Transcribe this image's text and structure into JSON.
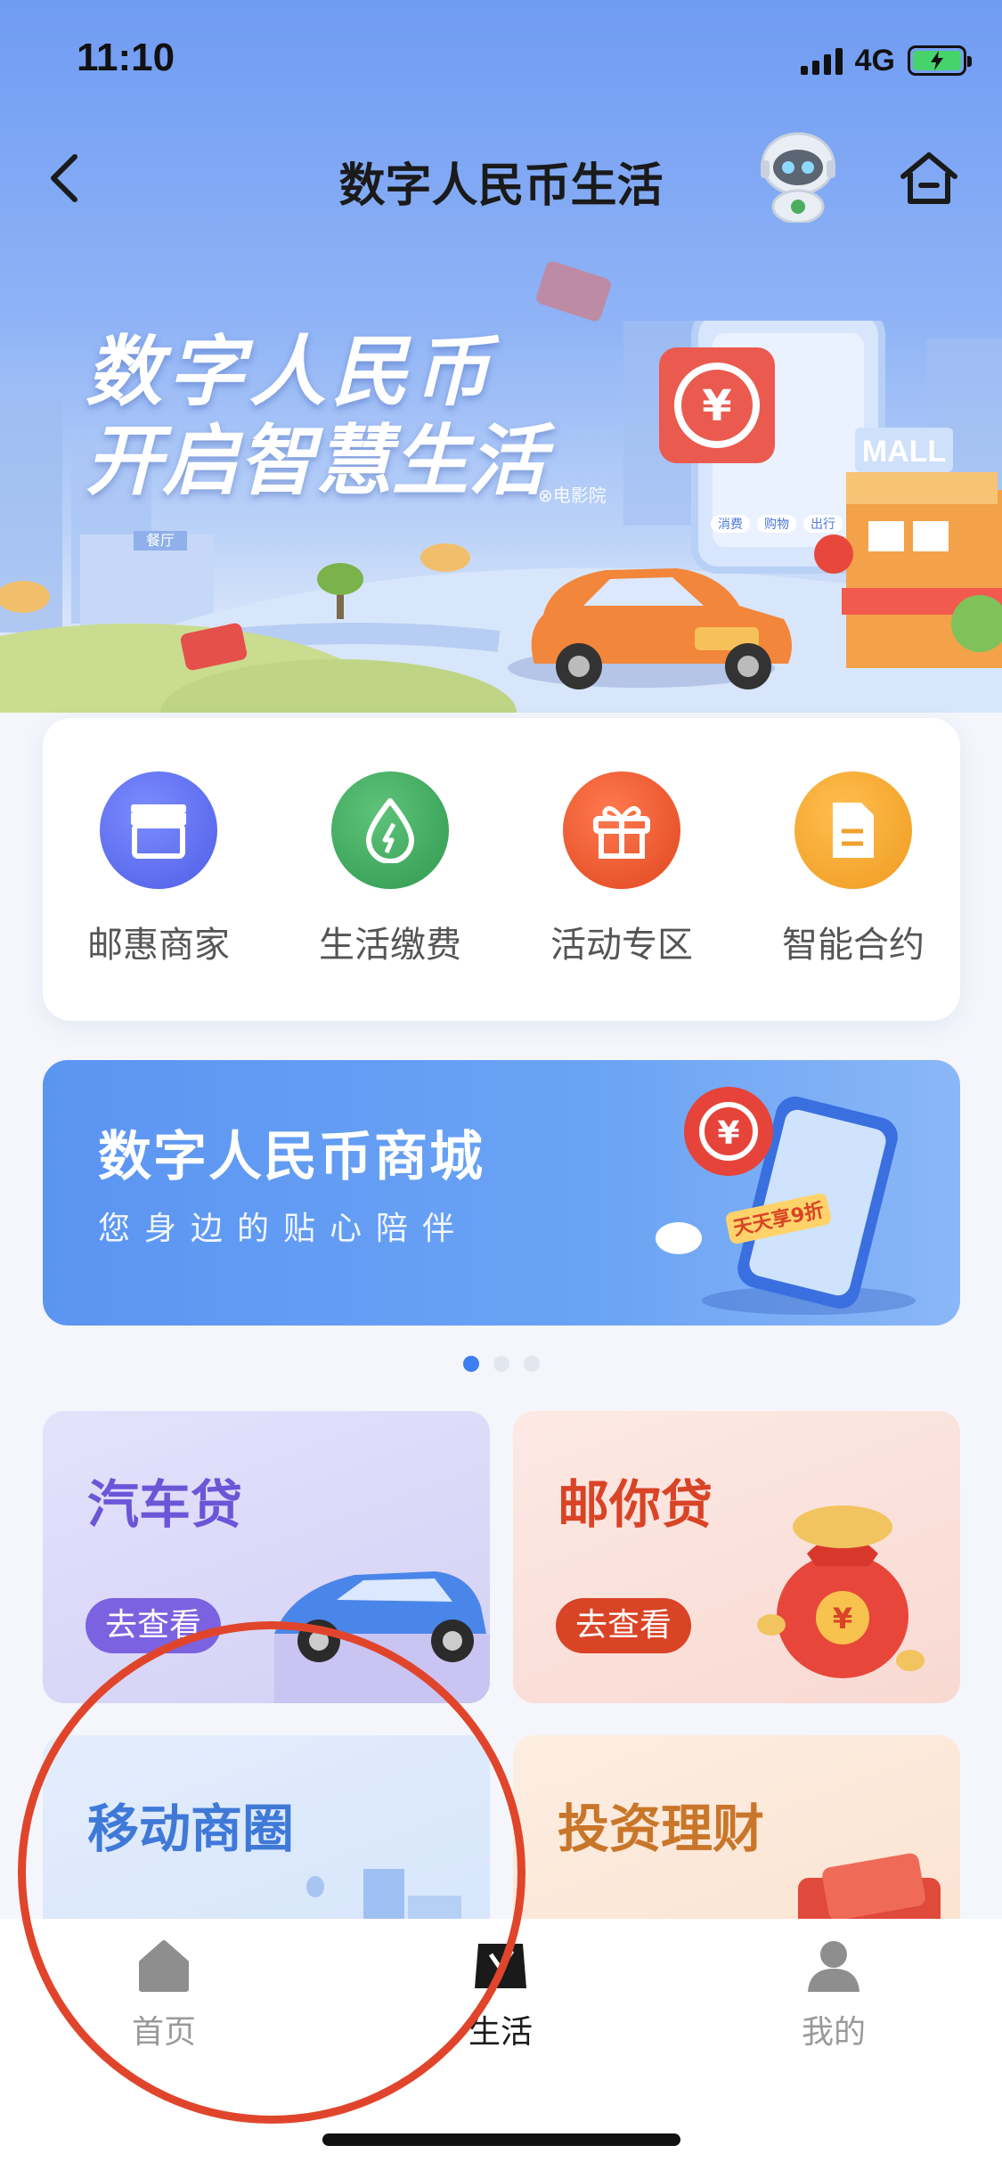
{
  "status_bar": {
    "time": "11:10",
    "network": "4G",
    "battery_level": 0.7
  },
  "nav": {
    "title": "数字人民币生活",
    "back_icon": "chevron-left-icon",
    "home_icon": "home-icon",
    "avatar_icon": "robot-avatar"
  },
  "hero": {
    "slogan_line1": "数字人民币",
    "slogan_line2": "开启智慧生活",
    "watermark": "⊗电影院",
    "mall_sign": "MALL",
    "restaurant_sign": "餐厅",
    "phone_tags": [
      "消费",
      "购物",
      "出行"
    ]
  },
  "quick_entries": [
    {
      "label": "邮惠商家",
      "icon": "store-icon",
      "color": "#5b6cf0"
    },
    {
      "label": "生活缴费",
      "icon": "utility-drop-icon",
      "color": "#3aa65c"
    },
    {
      "label": "活动专区",
      "icon": "gift-icon",
      "color": "#ec5a2f"
    },
    {
      "label": "智能合约",
      "icon": "document-icon",
      "color": "#f2a12c"
    }
  ],
  "mall_banner": {
    "title": "数字人民币商城",
    "subtitle": "您身边的贴心陪伴",
    "promo_tag": "天天享9折"
  },
  "carousel": {
    "pages": 3,
    "active": 1
  },
  "tiles": [
    {
      "title": "汽车贷",
      "button": "去查看",
      "title_color": "#6b56d8",
      "bg": "#dcdaf7",
      "btn_color": "#7b62e0"
    },
    {
      "title": "邮你贷",
      "button": "去查看",
      "title_color": "#d94326",
      "bg": "#fbe3de",
      "btn_color": "#d94326"
    },
    {
      "title": "移动商圈",
      "title_color": "#3f79d8",
      "bg": "#dce8fb"
    },
    {
      "title": "投资理财",
      "title_color": "#c9762a",
      "bg": "#fbe8da"
    }
  ],
  "tab_bar": {
    "tabs": [
      {
        "label": "首页",
        "icon": "home-tab-icon",
        "active": false
      },
      {
        "label": "生活",
        "icon": "life-tab-icon",
        "active": true
      },
      {
        "label": "我的",
        "icon": "profile-tab-icon",
        "active": false
      }
    ]
  },
  "colors": {
    "accent": "#3d7ff0",
    "annotation": "#e0452c"
  }
}
